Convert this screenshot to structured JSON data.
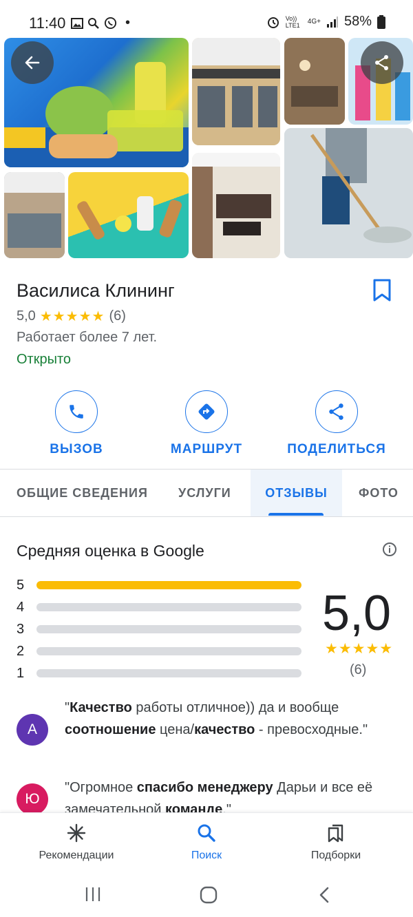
{
  "status_bar": {
    "time": "11:40",
    "battery": "58%",
    "network": "4G+",
    "volte": "Vo)) LTE1"
  },
  "place": {
    "name": "Василиса Клининг",
    "rating": "5,0",
    "rating_stars": "★★★★★",
    "review_count": "(6)",
    "description": "Работает более 7 лет.",
    "status": "Открыто",
    "status_color": "#188038"
  },
  "actions": [
    {
      "label": "ВЫЗОВ",
      "icon": "phone-icon"
    },
    {
      "label": "МАРШРУТ",
      "icon": "directions-icon"
    },
    {
      "label": "ПОДЕЛИТЬСЯ",
      "icon": "share-icon"
    }
  ],
  "tabs": [
    {
      "label": "ОБЩИЕ СВЕДЕНИЯ",
      "active": false
    },
    {
      "label": "УСЛУГИ",
      "active": false
    },
    {
      "label": "ОТЗЫВЫ",
      "active": true
    },
    {
      "label": "ФОТО",
      "active": false
    }
  ],
  "ratings": {
    "title": "Средняя оценка в Google",
    "score": "5,0",
    "stars": "★★★★★",
    "count": "(6)",
    "distribution": [
      {
        "stars": "5",
        "fraction": 1.0
      },
      {
        "stars": "4",
        "fraction": 0.0
      },
      {
        "stars": "3",
        "fraction": 0.0
      },
      {
        "stars": "2",
        "fraction": 0.0
      },
      {
        "stars": "1",
        "fraction": 0.0
      }
    ]
  },
  "reviews": [
    {
      "initial": "A",
      "avatar_color": "#5e35b1",
      "parts": [
        {
          "t": "\"",
          "b": false
        },
        {
          "t": "Качество",
          "b": true
        },
        {
          "t": " работы отличное)) да и вообще ",
          "b": false
        },
        {
          "t": "соотношение",
          "b": true
        },
        {
          "t": " цена/",
          "b": false
        },
        {
          "t": "качество",
          "b": true
        },
        {
          "t": " - превосходные.\"",
          "b": false
        }
      ]
    },
    {
      "initial": "Ю",
      "avatar_color": "#d81b60",
      "parts": [
        {
          "t": "\"Огромное ",
          "b": false
        },
        {
          "t": "спасибо менеджеру",
          "b": true
        },
        {
          "t": " Дарьи и все её замечательной ",
          "b": false
        },
        {
          "t": "команде",
          "b": true
        },
        {
          "t": ".\"",
          "b": false
        }
      ]
    }
  ],
  "bottom_nav": [
    {
      "label": "Рекомендации",
      "icon": "explore-asterisk-icon",
      "active": false
    },
    {
      "label": "Поиск",
      "icon": "search-icon",
      "active": true
    },
    {
      "label": "Подборки",
      "icon": "collections-icon",
      "active": false
    }
  ],
  "colors": {
    "accent": "#1a73e8",
    "star": "#fbbc04"
  }
}
